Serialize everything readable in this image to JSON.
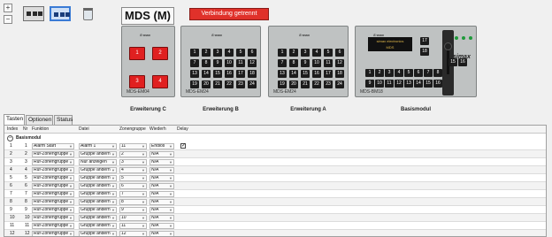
{
  "toolbar": {
    "add_label": "+",
    "remove_label": "−"
  },
  "title": "MDS (M)",
  "connection_status": "Verbindung getrennt",
  "colors": {
    "status_bg": "#e0312a",
    "selected_thumb": "#3a7bd5",
    "key_red": "#e02020"
  },
  "modules": [
    {
      "caption": "Erweiterung C",
      "model": "MDS-EM04",
      "keys": [
        "1",
        "2",
        "3",
        "4"
      ]
    },
    {
      "caption": "Erweiterung B",
      "model": "MDS-EM24",
      "keys": [
        "1",
        "2",
        "3",
        "4",
        "5",
        "6",
        "7",
        "8",
        "9",
        "10",
        "11",
        "12",
        "13",
        "14",
        "15",
        "16",
        "17",
        "18",
        "19",
        "20",
        "21",
        "22",
        "23",
        "24"
      ]
    },
    {
      "caption": "Erweiterung A",
      "model": "MDS-EM24",
      "keys": [
        "1",
        "2",
        "3",
        "4",
        "5",
        "6",
        "7",
        "8",
        "9",
        "10",
        "11",
        "12",
        "13",
        "14",
        "15",
        "16",
        "17",
        "18",
        "19",
        "20",
        "21",
        "22",
        "23",
        "24"
      ]
    },
    {
      "caption": "Basismodul",
      "model": "MDS-BM18",
      "lcd_line1": "simax electronics",
      "lcd_line2": "MDS",
      "brand": "simax",
      "keys": [
        "1",
        "2",
        "3",
        "4",
        "5",
        "6",
        "7",
        "8",
        "9",
        "10",
        "11",
        "12",
        "13",
        "14",
        "15",
        "16",
        "17",
        "18"
      ]
    }
  ],
  "tabs": [
    "Tasten",
    "Optionen",
    "Status"
  ],
  "table": {
    "headers": [
      "Index",
      "Nr",
      "Funktion",
      "Datei",
      "Zonengruppe",
      "Wiederh",
      "Delay"
    ],
    "group_label": "Basismodul",
    "rows": [
      {
        "index": "1",
        "nr": "1",
        "funktion": "Alarm Start",
        "datei": "Alarm 1",
        "zone": "11",
        "wiederh": "Endlos",
        "delay": ""
      },
      {
        "index": "2",
        "nr": "2",
        "funktion": "Ruf-Zonengruppe",
        "datei": "Gruppe ändern",
        "zone": "2",
        "wiederh": "N/A",
        "delay": ""
      },
      {
        "index": "3",
        "nr": "3",
        "funktion": "Ruf-Zonengruppe",
        "datei": "Nur anzeigen",
        "zone": "3",
        "wiederh": "N/A",
        "delay": ""
      },
      {
        "index": "4",
        "nr": "4",
        "funktion": "Ruf-Zonengruppe",
        "datei": "Gruppe ändern",
        "zone": "4",
        "wiederh": "N/A",
        "delay": ""
      },
      {
        "index": "5",
        "nr": "5",
        "funktion": "Ruf-Zonengruppe",
        "datei": "Gruppe ändern",
        "zone": "5",
        "wiederh": "N/A",
        "delay": ""
      },
      {
        "index": "6",
        "nr": "6",
        "funktion": "Ruf-Zonengruppe",
        "datei": "Gruppe ändern",
        "zone": "6",
        "wiederh": "N/A",
        "delay": ""
      },
      {
        "index": "7",
        "nr": "7",
        "funktion": "Ruf-Zonengruppe",
        "datei": "Gruppe ändern",
        "zone": "7",
        "wiederh": "N/A",
        "delay": ""
      },
      {
        "index": "8",
        "nr": "8",
        "funktion": "Ruf-Zonengruppe",
        "datei": "Gruppe ändern",
        "zone": "8",
        "wiederh": "N/A",
        "delay": ""
      },
      {
        "index": "9",
        "nr": "9",
        "funktion": "Ruf-Zonengruppe",
        "datei": "Gruppe ändern",
        "zone": "9",
        "wiederh": "N/A",
        "delay": ""
      },
      {
        "index": "10",
        "nr": "10",
        "funktion": "Ruf-Zonengruppe",
        "datei": "Gruppe ändern",
        "zone": "10",
        "wiederh": "N/A",
        "delay": ""
      },
      {
        "index": "11",
        "nr": "11",
        "funktion": "Ruf-Zonengruppe",
        "datei": "Gruppe ändern",
        "zone": "11",
        "wiederh": "N/A",
        "delay": ""
      },
      {
        "index": "12",
        "nr": "12",
        "funktion": "Ruf-Zonengruppe",
        "datei": "Gruppe ändern",
        "zone": "12",
        "wiederh": "N/A",
        "delay": ""
      }
    ]
  }
}
